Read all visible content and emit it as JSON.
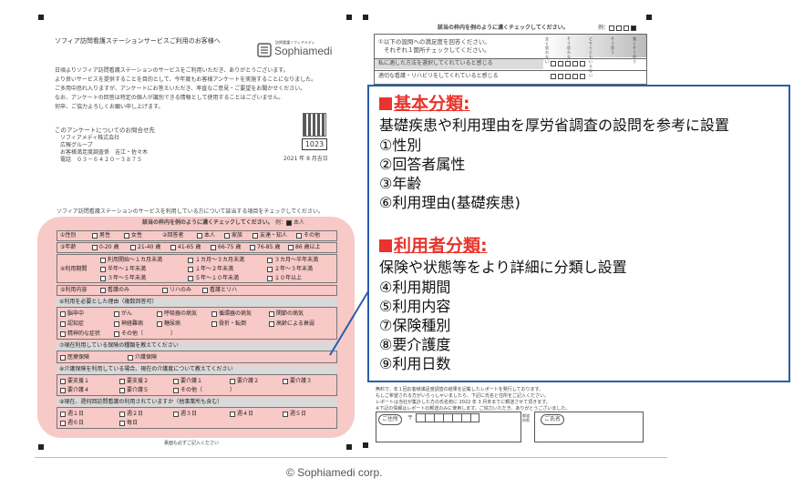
{
  "left_page": {
    "title": "ソフィア訪問看護ステーションサービスご利用のお客様へ",
    "logo_small": "訪問看護ソフィアメディ",
    "logo_text": "Sophiamedi",
    "intro_lines": [
      "日頃よりソフィア訪問看護ステーションのサービスをご利用いただき、ありがとうございます。",
      "より良いサービスを提供することを目的として、今年度もお客様アンケートを実施することになりました。",
      "ご多用中恐れ入りますが、アンケートにお答えいただき、率直なご意見・ご要望をお聞かせください。",
      "なお、アンケートの回答は特定の個人が識別できる情報として使用することはございません。",
      "何卒、ご協力よろしくお願い申し上げます。"
    ],
    "contact_title": "このアンケートについてのお問合せ先",
    "contact_lines": [
      "ソフィアメディ株式会社",
      "広報グループ",
      "お客様満足度調査係　吉江・佐々木",
      "電話　０３－６４２０－３８７５"
    ],
    "qr_number": "1023",
    "date": "2021 年 8 月吉日",
    "survey_instruction": "ソフィア訪問看護ステーションのサービスを利用している方について該当する項目をチェックしてください。",
    "check_instruction": "該当の枠内を例のように濃くチェックしてください。",
    "example_label": "例：",
    "example_value": "本人",
    "q1_label": "①性別",
    "q1_options": [
      "男性",
      "女性"
    ],
    "q2_label": "②回答者",
    "q2_options": [
      "本人",
      "家族",
      "友達・知人",
      "その他"
    ],
    "q3_label": "③年齢",
    "q3_options": [
      "0-20 歳",
      "21-40 歳",
      "41-65 歳",
      "66-75 歳",
      "76-85 歳",
      "86 歳以上"
    ],
    "q4_label": "④利用期間",
    "q4_options": [
      "利用開始～１カ月未満",
      "１カ月～３カ月未満",
      "３カ月～半年未満",
      "半年～１年未満",
      "１年～２年未満",
      "２年～３年未満",
      "３年～５年未満",
      "５年～１０年未満",
      "１０年以上"
    ],
    "q5_label": "⑤利用内容",
    "q5_options": [
      "看護のみ",
      "リハのみ",
      "看護とリハ"
    ],
    "q6_header": "⑥利用を必要とした理由（複数回答可）",
    "q6_options": [
      "脳卒中",
      "がん",
      "呼吸器の病気",
      "循環器の病気",
      "関節の病気",
      "認知症",
      "神経難病",
      "糖尿病",
      "骨折・転倒",
      "高齢による衰弱",
      "精神的な症状",
      "その他（　　　　　）"
    ],
    "q7_header": "⑦現在利用している保険の種類を教えてください",
    "q7_options": [
      "医療保険",
      "介護保険"
    ],
    "q8_header": "⑧介護保険を利用している場合、現在の介護度について教えてください",
    "q8_options": [
      "要支援１",
      "要支援２",
      "要介護１",
      "要介護２",
      "要介護３",
      "要介護４",
      "要介護５",
      "その他（　　　　　）"
    ],
    "q9_header": "⑨現在、週何回訪問看護の利用されていますか（他事業所も含む）",
    "q9_options": [
      "週１日",
      "週２日",
      "週３日",
      "週４日",
      "週５日",
      "週６日",
      "毎日"
    ],
    "footer_note": "裏面も必ずご記入ください"
  },
  "right_page": {
    "check_instruction": "該当の枠内を例のように濃くチェックしてください。",
    "example_label": "例：",
    "question_lines": [
      "①以下の設問への満足度を回答ください。",
      "それぞれ１箇所チェックしてください。"
    ],
    "scale_labels": [
      "全く思わない",
      "そう思わない",
      "どちらともいえない",
      "そう思う",
      "強くそう思う"
    ],
    "items": [
      "私に適した方法を選択してくれていると感じる",
      "適切な看護・リハビリをしてくれていると感じる"
    ],
    "bottom_text": [
      "無料で、年１回お客様満足度調査の結果を記載したレポートを発行しております。",
      "もしご希望される方がいらっしゃいましたら、下記に氏名と住所をご記入ください。",
      "レポートは当社が集計した方の氏名宛に 2022 年 3 月末までに郵送させて頂きます。",
      "※下記の情報はレポートの郵送のみに使用します。ご協力いただき、ありがとうございました。"
    ],
    "address_label": "ご住所",
    "postal_mark": "〒",
    "side_label_1": "都道府県",
    "name_label": "ご氏名"
  },
  "callout": {
    "basic_title": "基本分類:",
    "basic_desc": "基礎疾患や利用理由を厚労省調査の設問を参考に設置",
    "basic_items": [
      "①性別",
      "②回答者属性",
      "③年齢",
      "⑥利用理由(基礎疾患)"
    ],
    "user_title": "利用者分類:",
    "user_desc": "保険や状態等をより詳細に分類し設置",
    "user_items": [
      "④利用期間",
      "⑤利用内容",
      "⑦保険種別",
      "⑧要介護度",
      "⑨利用日数"
    ]
  },
  "copyright": "© Sophiamedi corp."
}
